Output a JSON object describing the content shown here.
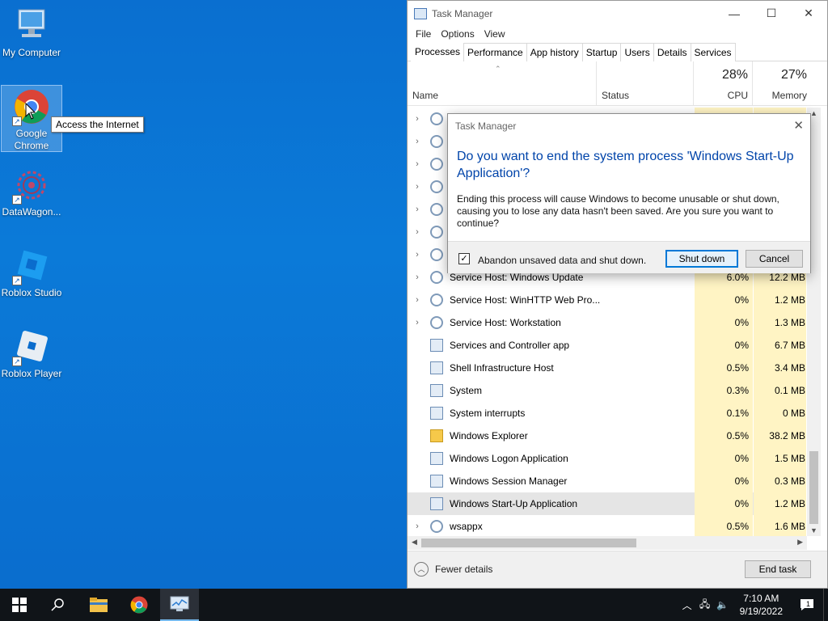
{
  "desktop": {
    "icons": [
      {
        "label": "My Computer",
        "icon": "computer-icon"
      },
      {
        "label": "Google Chrome",
        "icon": "chrome-icon"
      },
      {
        "label": "DataWagon...",
        "icon": "datawagon-icon"
      },
      {
        "label": "Roblox Studio",
        "icon": "roblox-studio-icon"
      },
      {
        "label": "Roblox Player",
        "icon": "roblox-player-icon"
      }
    ],
    "tooltip": "Access the Internet"
  },
  "taskmanager": {
    "title": "Task Manager",
    "menu": [
      "File",
      "Options",
      "View"
    ],
    "tabs": [
      "Processes",
      "Performance",
      "App history",
      "Startup",
      "Users",
      "Details",
      "Services"
    ],
    "active_tab": "Processes",
    "columns": {
      "name": "Name",
      "status": "Status",
      "cpu_pct": "28%",
      "cpu": "CPU",
      "mem_pct": "27%",
      "memory": "Memory"
    },
    "processes": [
      {
        "name": "",
        "cpu": "",
        "mem": "",
        "expand": true,
        "icon": "gear"
      },
      {
        "name": "",
        "cpu": "",
        "mem": "",
        "expand": true,
        "icon": "gear"
      },
      {
        "name": "",
        "cpu": "",
        "mem": "",
        "expand": true,
        "icon": "gear"
      },
      {
        "name": "",
        "cpu": "",
        "mem": "",
        "expand": true,
        "icon": "gear"
      },
      {
        "name": "",
        "cpu": "",
        "mem": "",
        "expand": true,
        "icon": "gear"
      },
      {
        "name": "",
        "cpu": "",
        "mem": "",
        "expand": true,
        "icon": "gear"
      },
      {
        "name": "",
        "cpu": "",
        "mem": "",
        "expand": true,
        "icon": "gear"
      },
      {
        "name": "Service Host: Windows Update",
        "cpu": "6.0%",
        "mem": "12.2 MB",
        "expand": true,
        "icon": "gear"
      },
      {
        "name": "Service Host: WinHTTP Web Pro...",
        "cpu": "0%",
        "mem": "1.2 MB",
        "expand": true,
        "icon": "gear"
      },
      {
        "name": "Service Host: Workstation",
        "cpu": "0%",
        "mem": "1.3 MB",
        "expand": true,
        "icon": "gear"
      },
      {
        "name": "Services and Controller app",
        "cpu": "0%",
        "mem": "6.7 MB",
        "expand": false,
        "icon": "app"
      },
      {
        "name": "Shell Infrastructure Host",
        "cpu": "0.5%",
        "mem": "3.4 MB",
        "expand": false,
        "icon": "app"
      },
      {
        "name": "System",
        "cpu": "0.3%",
        "mem": "0.1 MB",
        "expand": false,
        "icon": "app"
      },
      {
        "name": "System interrupts",
        "cpu": "0.1%",
        "mem": "0 MB",
        "expand": false,
        "icon": "app"
      },
      {
        "name": "Windows Explorer",
        "cpu": "0.5%",
        "mem": "38.2 MB",
        "expand": false,
        "icon": "folder"
      },
      {
        "name": "Windows Logon Application",
        "cpu": "0%",
        "mem": "1.5 MB",
        "expand": false,
        "icon": "app"
      },
      {
        "name": "Windows Session Manager",
        "cpu": "0%",
        "mem": "0.3 MB",
        "expand": false,
        "icon": "app"
      },
      {
        "name": "Windows Start-Up Application",
        "cpu": "0%",
        "mem": "1.2 MB",
        "expand": false,
        "icon": "app",
        "selected": true
      },
      {
        "name": "wsappx",
        "cpu": "0.5%",
        "mem": "1.6 MB",
        "expand": true,
        "icon": "gear"
      }
    ],
    "fewer_details": "Fewer details",
    "end_task": "End task"
  },
  "dialog": {
    "title": "Task Manager",
    "heading": "Do you want to end the system process 'Windows Start-Up Application'?",
    "body": "Ending this process will cause Windows to become unusable or shut down, causing you to lose any data hasn't been saved. Are you sure you want to continue?",
    "checkbox_label": "Abandon unsaved data and shut down.",
    "checkbox_checked": true,
    "shutdown": "Shut down",
    "cancel": "Cancel"
  },
  "taskbar": {
    "time": "7:10 AM",
    "date": "9/19/2022",
    "notification_count": "1"
  }
}
